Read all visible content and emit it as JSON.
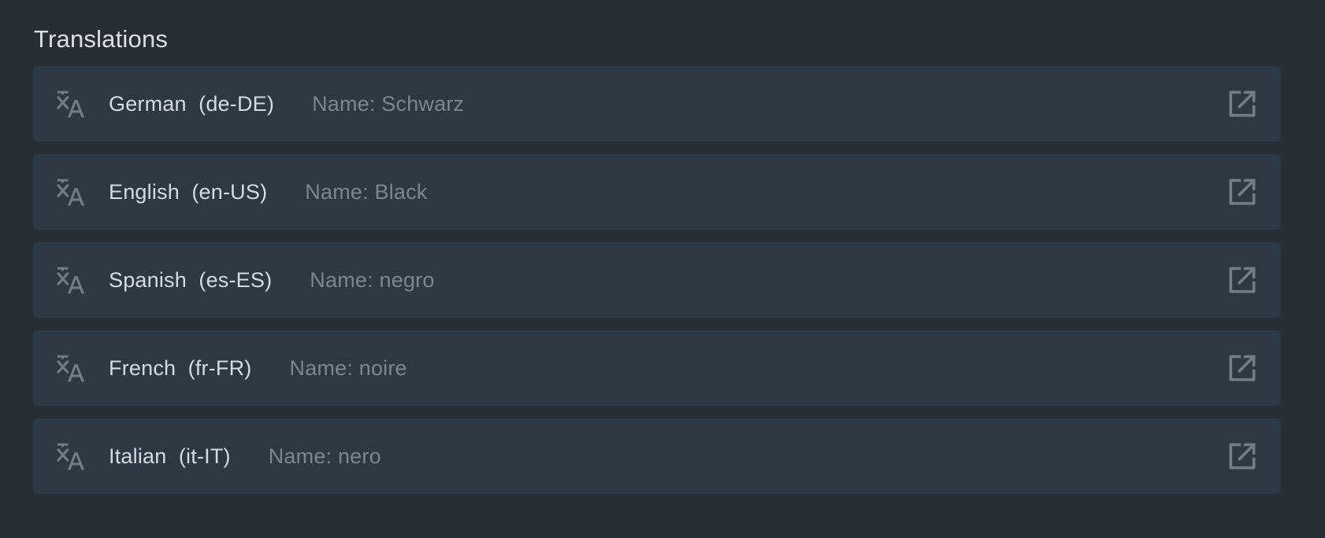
{
  "section": {
    "title": "Translations"
  },
  "translations": [
    {
      "language": "German  (de-DE)",
      "name": "Name: Schwarz"
    },
    {
      "language": "English  (en-US)",
      "name": "Name: Black"
    },
    {
      "language": "Spanish  (es-ES)",
      "name": "Name: negro"
    },
    {
      "language": "French  (fr-FR)",
      "name": "Name: noire"
    },
    {
      "language": "Italian  (it-IT)",
      "name": "Name: nero"
    }
  ],
  "icons": {
    "row_icon": "translate-icon",
    "action_icon": "open-in-new-icon"
  },
  "colors": {
    "background": "#252e35",
    "row": "#2d3942",
    "icon": "#6f7d86"
  }
}
